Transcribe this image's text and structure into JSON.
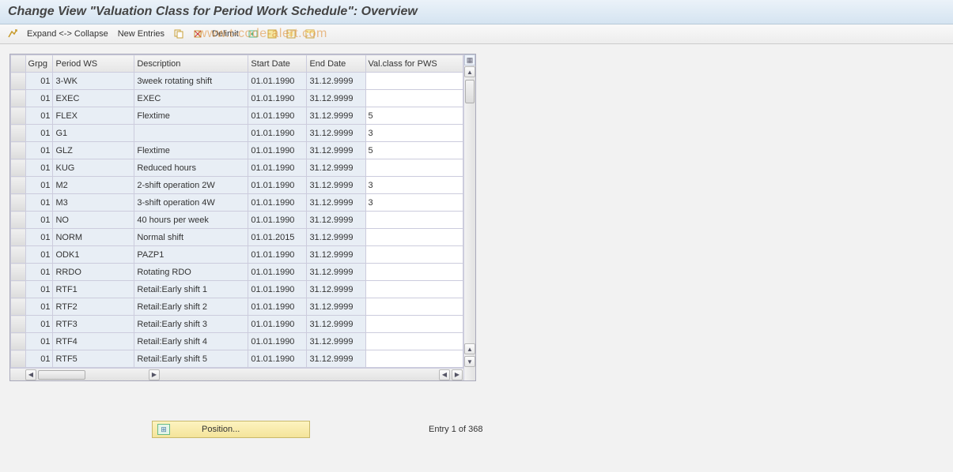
{
  "title": "Change View \"Valuation Class for Period Work Schedule\": Overview",
  "toolbar": {
    "expand_collapse": "Expand <-> Collapse",
    "new_entries": "New Entries",
    "delimit": "Delimit"
  },
  "watermark": "www.t-code-alert.com",
  "table": {
    "headers": {
      "grpg": "Grpg",
      "period_ws": "Period WS",
      "description": "Description",
      "start_date": "Start Date",
      "end_date": "End Date",
      "val_class": "Val.class for PWS"
    },
    "rows": [
      {
        "grpg": "01",
        "pws": "3-WK",
        "desc": "3week rotating shift",
        "start": "01.01.1990",
        "end": "31.12.9999",
        "val": ""
      },
      {
        "grpg": "01",
        "pws": "EXEC",
        "desc": "EXEC",
        "start": "01.01.1990",
        "end": "31.12.9999",
        "val": ""
      },
      {
        "grpg": "01",
        "pws": "FLEX",
        "desc": "Flextime",
        "start": "01.01.1990",
        "end": "31.12.9999",
        "val": "5"
      },
      {
        "grpg": "01",
        "pws": "G1",
        "desc": "",
        "start": "01.01.1990",
        "end": "31.12.9999",
        "val": "3"
      },
      {
        "grpg": "01",
        "pws": "GLZ",
        "desc": "Flextime",
        "start": "01.01.1990",
        "end": "31.12.9999",
        "val": "5"
      },
      {
        "grpg": "01",
        "pws": "KUG",
        "desc": "Reduced hours",
        "start": "01.01.1990",
        "end": "31.12.9999",
        "val": ""
      },
      {
        "grpg": "01",
        "pws": "M2",
        "desc": "2-shift operation 2W",
        "start": "01.01.1990",
        "end": "31.12.9999",
        "val": "3"
      },
      {
        "grpg": "01",
        "pws": "M3",
        "desc": "3-shift operation 4W",
        "start": "01.01.1990",
        "end": "31.12.9999",
        "val": "3"
      },
      {
        "grpg": "01",
        "pws": "NO",
        "desc": "40 hours per week",
        "start": "01.01.1990",
        "end": "31.12.9999",
        "val": ""
      },
      {
        "grpg": "01",
        "pws": "NORM",
        "desc": "Normal shift",
        "start": "01.01.2015",
        "end": "31.12.9999",
        "val": ""
      },
      {
        "grpg": "01",
        "pws": "ODK1",
        "desc": "PAZP1",
        "start": "01.01.1990",
        "end": "31.12.9999",
        "val": ""
      },
      {
        "grpg": "01",
        "pws": "RRDO",
        "desc": "Rotating RDO",
        "start": "01.01.1990",
        "end": "31.12.9999",
        "val": ""
      },
      {
        "grpg": "01",
        "pws": "RTF1",
        "desc": "Retail:Early shift 1",
        "start": "01.01.1990",
        "end": "31.12.9999",
        "val": ""
      },
      {
        "grpg": "01",
        "pws": "RTF2",
        "desc": "Retail:Early shift 2",
        "start": "01.01.1990",
        "end": "31.12.9999",
        "val": ""
      },
      {
        "grpg": "01",
        "pws": "RTF3",
        "desc": "Retail:Early shift 3",
        "start": "01.01.1990",
        "end": "31.12.9999",
        "val": ""
      },
      {
        "grpg": "01",
        "pws": "RTF4",
        "desc": "Retail:Early shift 4",
        "start": "01.01.1990",
        "end": "31.12.9999",
        "val": ""
      },
      {
        "grpg": "01",
        "pws": "RTF5",
        "desc": "Retail:Early shift 5",
        "start": "01.01.1990",
        "end": "31.12.9999",
        "val": ""
      }
    ]
  },
  "footer": {
    "position_label": "Position...",
    "entry_status": "Entry 1 of 368"
  }
}
